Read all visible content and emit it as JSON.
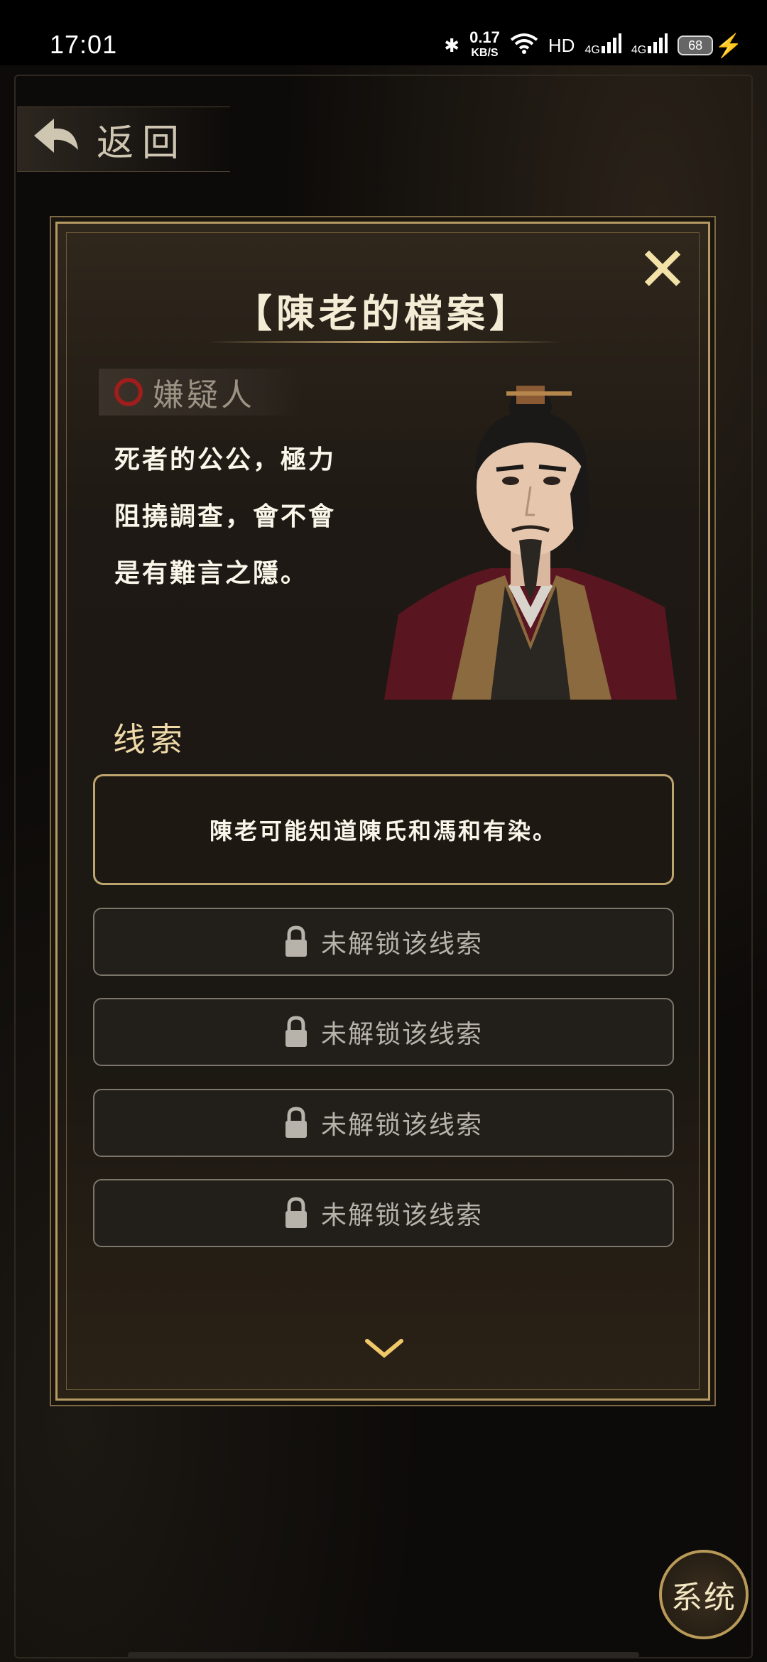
{
  "status_bar": {
    "time": "17:01",
    "net_speed": "0.17",
    "net_unit": "KB/S",
    "hd": "HD",
    "signal1": "4G",
    "signal2": "4G",
    "battery": "68"
  },
  "nav": {
    "back_label": "返回"
  },
  "panel": {
    "title": "【陳老的檔案】",
    "tag_label": "嫌疑人",
    "description_lines": [
      "死者的公公，極力",
      "阻撓調查，會不會",
      "是有難言之隱。"
    ],
    "clues_heading": "线索",
    "clue_unlocked": "陳老可能知道陳氏和馮和有染。",
    "locked_clues": [
      "未解锁该线索",
      "未解锁该线索",
      "未解锁该线索",
      "未解锁该线索"
    ]
  },
  "system_button": {
    "label": "系统"
  },
  "icons": {
    "close": "close-icon",
    "back": "back-arrow-icon",
    "lock": "lock-icon",
    "more": "chevron-down-icon"
  },
  "colors": {
    "accent_gold": "#b59a63",
    "suspect_red": "#9e1d1d",
    "panel_bg": "#1e1914"
  }
}
